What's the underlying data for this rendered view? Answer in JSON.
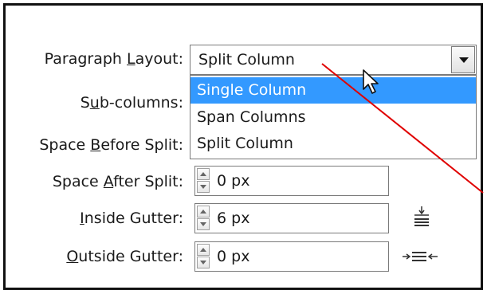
{
  "labels": {
    "paragraph_layout": "Paragraph Layout:",
    "sub_columns": "Sub-columns:",
    "space_before_split": "Space Before Split:",
    "space_after_split": "Space After Split:",
    "inside_gutter": "Inside Gutter:",
    "outside_gutter": "Outside Gutter:"
  },
  "paragraph_layout": {
    "selected": "Split Column",
    "options": [
      "Single Column",
      "Span Columns",
      "Split Column"
    ],
    "highlighted_index": 0
  },
  "fields": {
    "space_after_split": "0 px",
    "inside_gutter": "6 px",
    "outside_gutter": "0 px"
  },
  "icons": {
    "inside_gutter": "inside-gutter-icon",
    "outside_gutter": "outside-gutter-icon",
    "cursor": "mouse-pointer-icon"
  },
  "colors": {
    "highlight": "#3399ff",
    "annotation_line": "#e00000"
  }
}
